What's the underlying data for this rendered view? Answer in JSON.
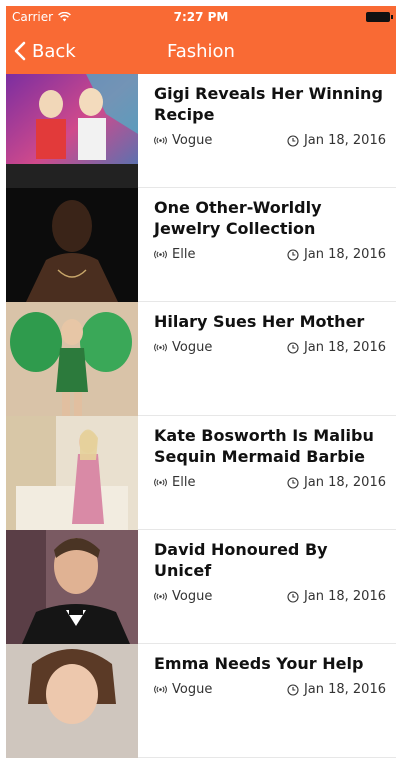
{
  "status_bar": {
    "carrier": "Carrier",
    "time": "7:27 PM"
  },
  "nav": {
    "back_label": "Back",
    "title": "Fashion"
  },
  "colors": {
    "accent": "#f96a34"
  },
  "articles": [
    {
      "title": "Gigi Reveals Her Winning Recipe",
      "source": "Vogue",
      "date": "Jan 18, 2016"
    },
    {
      "title": "One Other-Worldly Jewelry Collection",
      "source": "Elle",
      "date": "Jan 18, 2016"
    },
    {
      "title": "Hilary Sues Her Mother",
      "source": "Vogue",
      "date": "Jan 18, 2016"
    },
    {
      "title": "Kate Bosworth Is Malibu Sequin Mermaid Barbie",
      "source": "Elle",
      "date": "Jan 18, 2016"
    },
    {
      "title": "David Honoured By Unicef",
      "source": "Vogue",
      "date": "Jan 18, 2016"
    },
    {
      "title": "Emma Needs Your Help",
      "source": "Vogue",
      "date": "Jan 18, 2016"
    }
  ]
}
